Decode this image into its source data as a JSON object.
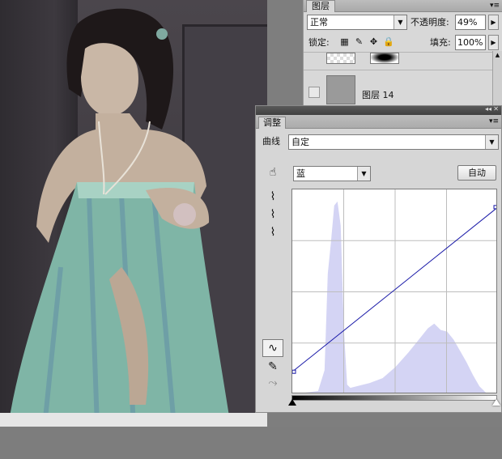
{
  "layers_panel": {
    "tab_label": "图层",
    "menu_icon": "panel-menu-icon",
    "blend_mode": "正常",
    "opacity_label": "不透明度:",
    "opacity_value": "49%",
    "lock_label": "锁定:",
    "lock_icons": [
      "lock-transparent-icon",
      "lock-brush-icon",
      "lock-move-icon",
      "lock-all-icon"
    ],
    "fill_label": "填充:",
    "fill_value": "100%",
    "layers": [
      {
        "name": ""
      },
      {
        "name": "图层 14"
      }
    ]
  },
  "adjust_panel": {
    "tab_label": "调整",
    "preset_label": "曲线",
    "preset_value": "自定",
    "channel_value": "蓝",
    "auto_button": "自动",
    "tools": [
      "hand-adjust-icon",
      "eyedropper-black-icon",
      "eyedropper-gray-icon",
      "eyedropper-white-icon",
      "curve-point-icon",
      "pencil-icon",
      "smooth-icon"
    ]
  },
  "chart_data": {
    "type": "area",
    "title": "",
    "xlabel": "",
    "ylabel": "",
    "xlim": [
      0,
      255
    ],
    "ylim": [
      0,
      255
    ],
    "grid": "4x4",
    "curve": {
      "points": [
        [
          0,
          28
        ],
        [
          255,
          233
        ]
      ],
      "color": "#1a1aa8"
    },
    "histogram": {
      "color": "#d4d4f4",
      "x": [
        0,
        16,
        32,
        40,
        44,
        48,
        52,
        56,
        60,
        64,
        68,
        72,
        80,
        96,
        112,
        128,
        144,
        152,
        160,
        168,
        176,
        184,
        192,
        200,
        208,
        216,
        224,
        232,
        240,
        255
      ],
      "values": [
        0,
        2,
        4,
        30,
        150,
        190,
        235,
        240,
        210,
        80,
        12,
        8,
        10,
        14,
        20,
        34,
        52,
        62,
        72,
        82,
        88,
        80,
        78,
        68,
        54,
        40,
        24,
        10,
        2,
        0
      ]
    }
  }
}
